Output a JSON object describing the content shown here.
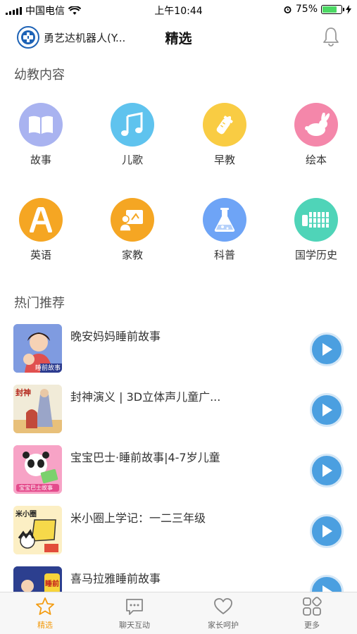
{
  "status_bar": {
    "carrier": "中国电信",
    "time": "上午10:44",
    "battery": "75%",
    "battery_level": 0.75
  },
  "header": {
    "brand_name": "勇艺达机器人(Y...",
    "title": "精选",
    "bell_icon": "bell-icon"
  },
  "sections": {
    "kids": "幼教内容",
    "hot": "热门推荐"
  },
  "categories": [
    {
      "label": "故事",
      "color": "#a9b3f0",
      "icon": "book-icon"
    },
    {
      "label": "儿歌",
      "color": "#5fc3ee",
      "icon": "music-note-icon"
    },
    {
      "label": "早教",
      "color": "#f9cc43",
      "icon": "baby-bottle-icon"
    },
    {
      "label": "绘本",
      "color": "#f487aa",
      "icon": "rabbit-icon"
    },
    {
      "label": "英语",
      "color": "#f5a623",
      "icon": "letter-a-icon"
    },
    {
      "label": "家教",
      "color": "#f5a623",
      "icon": "teacher-board-icon"
    },
    {
      "label": "科普",
      "color": "#6ea4f6",
      "icon": "flask-icon"
    },
    {
      "label": "国学历史",
      "color": "#4fd4b8",
      "icon": "bamboo-scroll-icon"
    }
  ],
  "recommendations": [
    {
      "title": "晚安妈妈睡前故事",
      "thumb_text": "睡前故事"
    },
    {
      "title": "封神演义 | 3D立体声儿童广...",
      "thumb_text": "封神"
    },
    {
      "title": "宝宝巴士·睡前故事|4-7岁儿童",
      "thumb_text": "宝宝巴士故事"
    },
    {
      "title": "米小圈上学记：一二三年级",
      "thumb_text": "米小圈"
    },
    {
      "title": "喜马拉雅睡前故事",
      "thumb_text": "睡前"
    }
  ],
  "tabs": [
    {
      "label": "精选",
      "icon": "star-icon",
      "active": true
    },
    {
      "label": "聊天互动",
      "icon": "chat-bubble-icon",
      "active": false
    },
    {
      "label": "家长呵护",
      "icon": "heart-icon",
      "active": false
    },
    {
      "label": "更多",
      "icon": "grid-icon",
      "active": false
    }
  ],
  "colors": {
    "accent": "#f39c12",
    "play": "#4b9fe0"
  }
}
